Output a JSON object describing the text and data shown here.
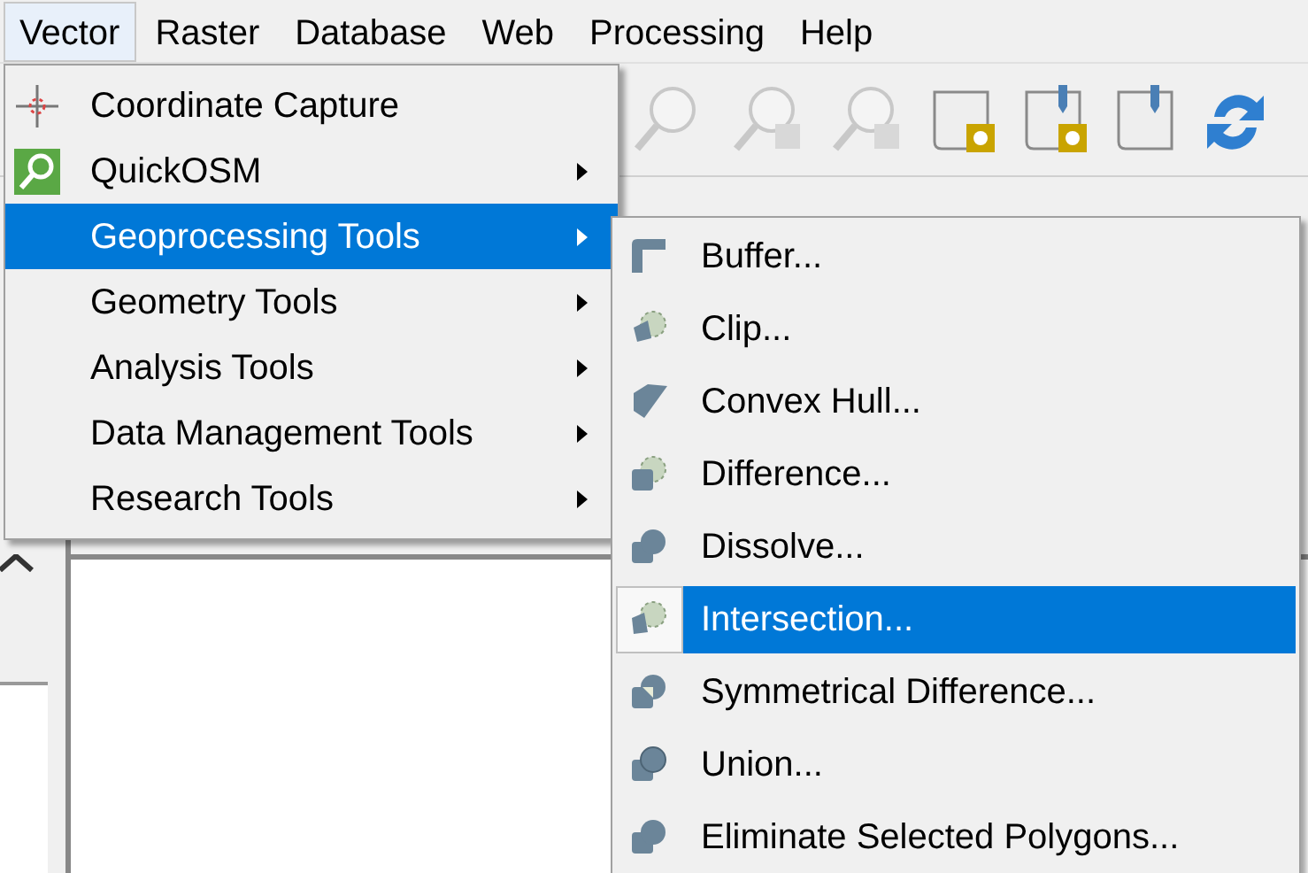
{
  "menubar": [
    {
      "label": "Vector",
      "selected": true
    },
    {
      "label": "Raster",
      "selected": false
    },
    {
      "label": "Database",
      "selected": false
    },
    {
      "label": "Web",
      "selected": false
    },
    {
      "label": "Processing",
      "selected": false
    },
    {
      "label": "Help",
      "selected": false
    }
  ],
  "toolbar": {
    "buttons": [
      {
        "disabled": true
      },
      {
        "disabled": true
      },
      {
        "disabled": true
      },
      {
        "disabled": false
      },
      {
        "disabled": false
      },
      {
        "disabled": false
      },
      {
        "disabled": false
      }
    ]
  },
  "vector_menu": {
    "items": [
      {
        "label": "Coordinate Capture",
        "submenu": false,
        "selected": false
      },
      {
        "label": "QuickOSM",
        "submenu": true,
        "selected": false
      },
      {
        "label": "Geoprocessing Tools",
        "submenu": true,
        "selected": true
      },
      {
        "label": "Geometry Tools",
        "submenu": true,
        "selected": false
      },
      {
        "label": "Analysis Tools",
        "submenu": true,
        "selected": false
      },
      {
        "label": "Data Management Tools",
        "submenu": true,
        "selected": false
      },
      {
        "label": "Research Tools",
        "submenu": true,
        "selected": false
      }
    ]
  },
  "geoprocessing_menu": {
    "items": [
      {
        "label": "Buffer...",
        "selected": false
      },
      {
        "label": "Clip...",
        "selected": false
      },
      {
        "label": "Convex Hull...",
        "selected": false
      },
      {
        "label": "Difference...",
        "selected": false
      },
      {
        "label": "Dissolve...",
        "selected": false
      },
      {
        "label": "Intersection...",
        "selected": true
      },
      {
        "label": "Symmetrical Difference...",
        "selected": false
      },
      {
        "label": "Union...",
        "selected": false
      },
      {
        "label": "Eliminate Selected Polygons...",
        "selected": false
      }
    ]
  }
}
